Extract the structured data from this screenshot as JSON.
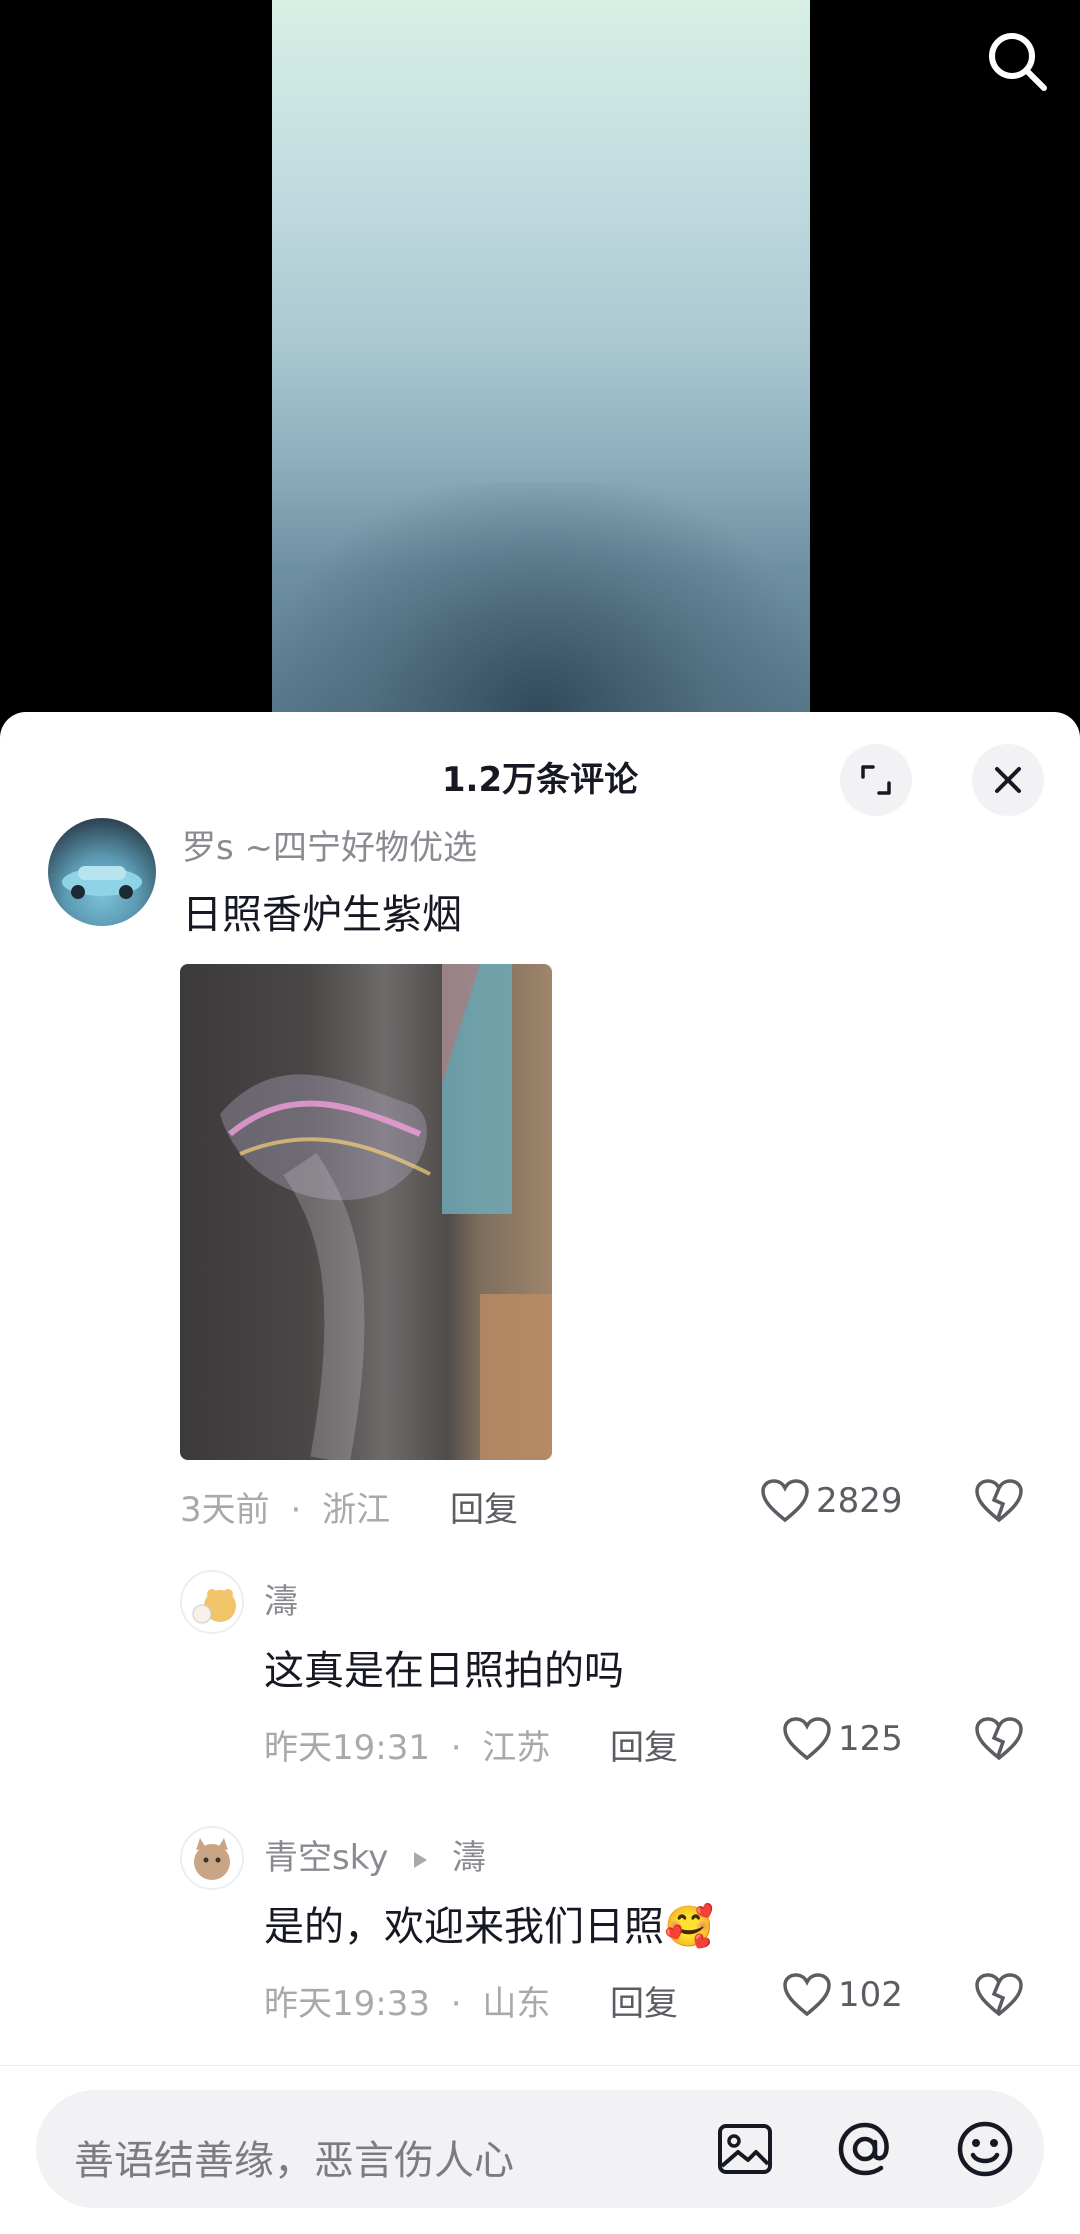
{
  "sheet": {
    "title": "1.2万条评论"
  },
  "comments": [
    {
      "name": "罗s ~四宁好物优选",
      "text": "日照香炉生紫烟",
      "time": "3天前",
      "location": "浙江",
      "reply": "回复",
      "likes": "2829"
    },
    {
      "name": "濤",
      "text": "这真是在日照拍的吗",
      "time": "昨天19:31",
      "location": "江苏",
      "reply": "回复",
      "likes": "125"
    },
    {
      "name": "青空sky",
      "reply_to": "濤",
      "text": "是的，欢迎来我们日照",
      "emoji": "🥰",
      "time": "昨天19:33",
      "location": "山东",
      "reply": "回复",
      "likes": "102"
    }
  ],
  "input": {
    "placeholder": "善语结善缘，恶言伤人心"
  },
  "dot": "·"
}
